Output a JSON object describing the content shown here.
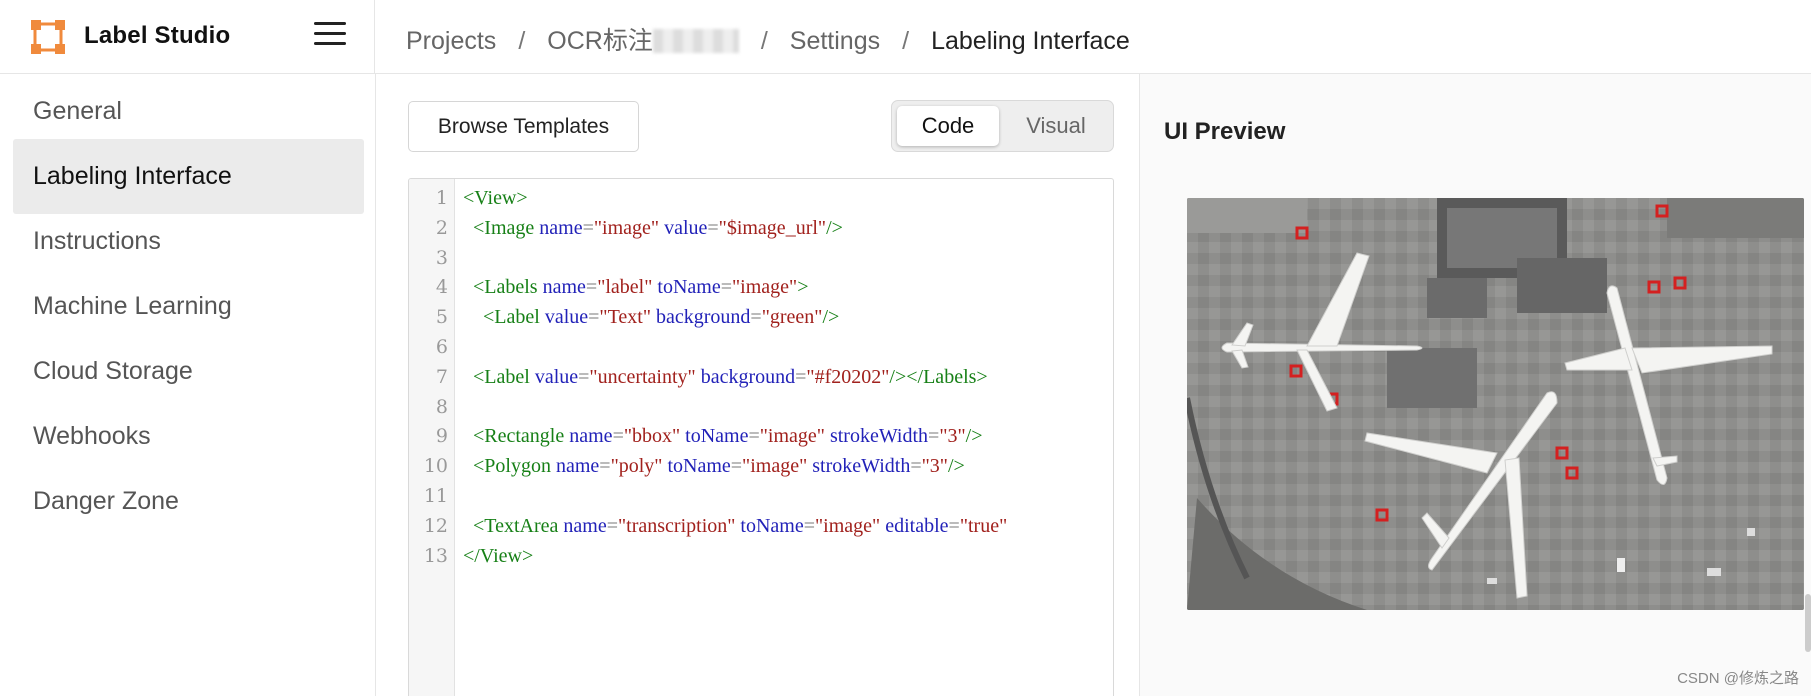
{
  "app": {
    "name": "Label Studio"
  },
  "breadcrumb": {
    "projects": "Projects",
    "project": "OCR标注",
    "settings": "Settings",
    "current": "Labeling Interface",
    "separator": "/"
  },
  "sidebar": {
    "items": [
      {
        "label": "General"
      },
      {
        "label": "Labeling Interface"
      },
      {
        "label": "Instructions"
      },
      {
        "label": "Machine Learning"
      },
      {
        "label": "Cloud Storage"
      },
      {
        "label": "Webhooks"
      },
      {
        "label": "Danger Zone"
      }
    ],
    "active": "Labeling Interface"
  },
  "editor": {
    "browse_templates": "Browse Templates",
    "mode_code": "Code",
    "mode_visual": "Visual",
    "active_mode": "Code",
    "line_numbers": [
      "1",
      "2",
      "3",
      "4",
      "5",
      "6",
      "7",
      "8",
      "9",
      "10",
      "11",
      "12",
      "13"
    ],
    "lines": [
      "<View>",
      "  <Image name=\"image\" value=\"$image_url\"/>",
      "",
      "  <Labels name=\"label\" toName=\"image\">",
      "    <Label value=\"Text\" background=\"green\"/>",
      "",
      "  <Label value=\"uncertainty\" background=\"#f20202\"/></Labels>",
      "",
      "  <Rectangle name=\"bbox\" toName=\"image\" strokeWidth=\"3\"/>",
      "  <Polygon name=\"poly\" toName=\"image\" strokeWidth=\"3\"/>",
      "",
      "  <TextArea name=\"transcription\" toName=\"image\" editable=\"true\"",
      "</View>"
    ]
  },
  "preview": {
    "title": "UI Preview"
  },
  "watermark": "CSDN @修炼之路",
  "colors": {
    "brand_orange": "#f08a3c",
    "tag_green": "#178017",
    "attr_blue": "#2222b8",
    "value_red": "#a1211d",
    "active_bg": "#ebebeb"
  }
}
